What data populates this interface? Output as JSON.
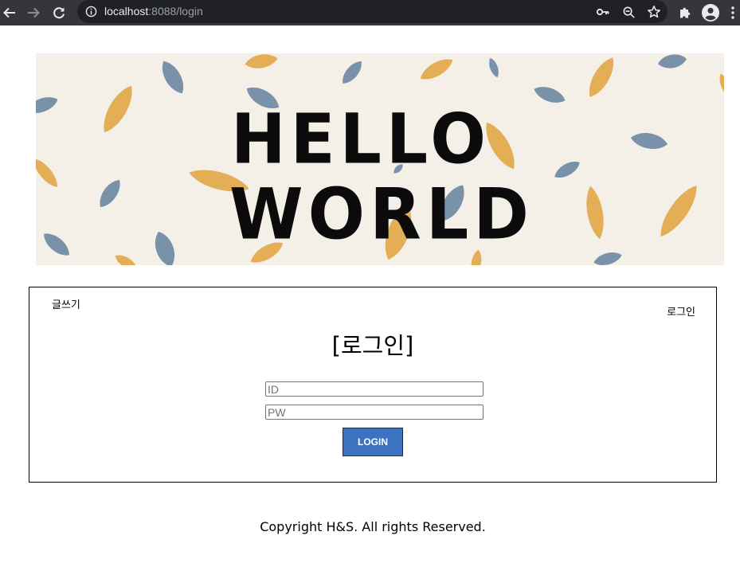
{
  "browser": {
    "url_host": "localhost",
    "url_rest": ":8088/login"
  },
  "banner": {
    "line1": "HELLO",
    "line2": "WORLD",
    "colors": {
      "background": "#f4f0e8",
      "leaf_orange": "#e3a94a",
      "leaf_blue": "#6f8ba5",
      "text": "#0b0b0b"
    }
  },
  "nav": {
    "write_label": "글쓰기",
    "login_label": "로그인"
  },
  "login_form": {
    "title": "[로그인]",
    "id_placeholder": "ID",
    "pw_placeholder": "PW",
    "id_value": "",
    "pw_value": "",
    "submit_label": "LOGIN",
    "button_color": "#3c73c1"
  },
  "footer": {
    "copyright": "Copyright H&S. All rights Reserved."
  },
  "icons": {
    "back": "arrow-left-icon",
    "forward": "arrow-right-icon",
    "reload": "reload-icon",
    "info": "info-icon",
    "key": "key-icon",
    "zoom": "zoom-out-icon",
    "bookmark": "star-icon",
    "extensions": "puzzle-icon",
    "profile": "avatar-icon",
    "menu": "kebab-menu-icon"
  }
}
